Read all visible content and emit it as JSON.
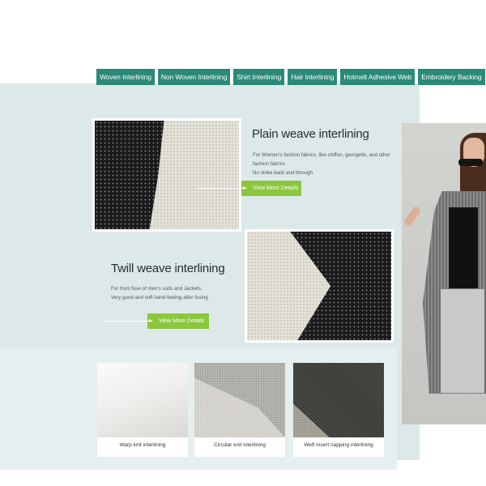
{
  "tabs": [
    "Woven Interlining",
    "Non Woven Interlining",
    "Shirt Interlining",
    "Hair Interlining",
    "Hotmelt Adhesive Web",
    "Embroidery Backing"
  ],
  "plain": {
    "title": "Plain weave interlining",
    "desc_line1": "For Women's fashion fabrics, like chiffon, georgette, and other fashion fabrics",
    "desc_line2": "No strike back and through",
    "button": "View More Details"
  },
  "twill": {
    "title": "Twill weave interlining",
    "desc_line1": "For front fuse of men's suits and Jackets.",
    "desc_line2": "Very good and soft hand-feeling after fusing",
    "button": "View More Details"
  },
  "cards": [
    {
      "caption": "Warp knit interlining"
    },
    {
      "caption": "Circular knit interlining"
    },
    {
      "caption": "Weft insert napping interlining"
    }
  ],
  "colors": {
    "tab_bg": "#2a8a78",
    "button_bg": "#8cc63f",
    "panel_bg": "#dde9e9"
  }
}
